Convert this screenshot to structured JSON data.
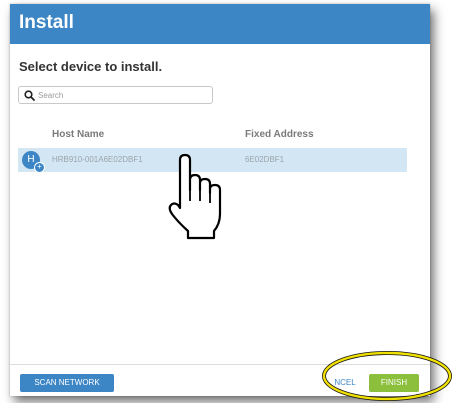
{
  "dialog": {
    "title": "Install",
    "subtitle": "Select device to install."
  },
  "search": {
    "placeholder": "Search",
    "icon": "search-icon"
  },
  "table": {
    "columns": [
      "Host Name",
      "Fixed Address"
    ],
    "rows": [
      {
        "avatar_letter": "H",
        "host_name": "HRB910-001A6E02DBF1",
        "fixed_address": "6E02DBF1",
        "selected": true
      }
    ]
  },
  "footer": {
    "scan_label": "SCAN NETWORK",
    "cancel_label": "NCEL",
    "finish_label": "FINISH"
  },
  "colors": {
    "header": "#3d86c6",
    "selected_row": "#d3e6f3",
    "finish": "#8bbf3c",
    "highlight": "#f0e000"
  }
}
